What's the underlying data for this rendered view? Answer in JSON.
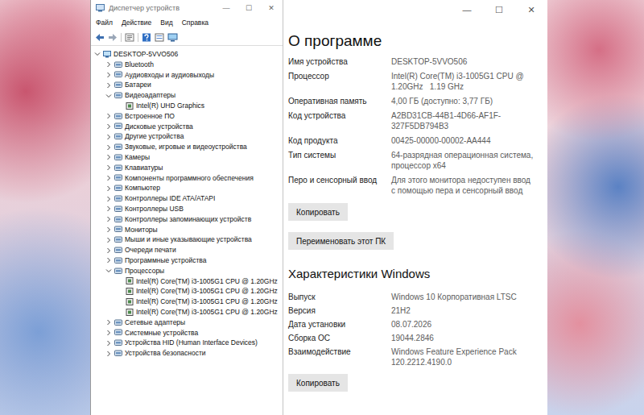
{
  "device_manager": {
    "title": "Диспетчер устройств",
    "controls": [
      "—",
      "☐",
      "✕"
    ],
    "menu": [
      "Файл",
      "Действие",
      "Вид",
      "Справка"
    ],
    "root": {
      "label": "DESKTOP-5VVO506",
      "expanded": true
    },
    "categories": [
      {
        "label": "Bluetooth",
        "expanded": false,
        "children": []
      },
      {
        "label": "Аудиовходы и аудиовыходы",
        "expanded": false,
        "children": []
      },
      {
        "label": "Батареи",
        "expanded": false,
        "children": []
      },
      {
        "label": "Видеоадаптеры",
        "expanded": true,
        "children": [
          "Intel(R) UHD Graphics"
        ]
      },
      {
        "label": "Встроенное ПО",
        "expanded": false,
        "children": []
      },
      {
        "label": "Дисковые устройства",
        "expanded": false,
        "children": []
      },
      {
        "label": "Другие устройства",
        "expanded": false,
        "children": []
      },
      {
        "label": "Звуковые, игровые и видеоустройства",
        "expanded": false,
        "children": []
      },
      {
        "label": "Камеры",
        "expanded": false,
        "children": []
      },
      {
        "label": "Клавиатуры",
        "expanded": false,
        "children": []
      },
      {
        "label": "Компоненты программного обеспечения",
        "expanded": false,
        "children": []
      },
      {
        "label": "Компьютер",
        "expanded": false,
        "children": []
      },
      {
        "label": "Контроллеры IDE ATA/ATAPI",
        "expanded": false,
        "children": []
      },
      {
        "label": "Контроллеры USB",
        "expanded": false,
        "children": []
      },
      {
        "label": "Контроллеры запоминающих устройств",
        "expanded": false,
        "children": []
      },
      {
        "label": "Мониторы",
        "expanded": false,
        "children": []
      },
      {
        "label": "Мыши и иные указывающие устройства",
        "expanded": false,
        "children": []
      },
      {
        "label": "Очереди печати",
        "expanded": false,
        "children": []
      },
      {
        "label": "Программные устройства",
        "expanded": false,
        "children": []
      },
      {
        "label": "Процессоры",
        "expanded": true,
        "children": [
          "Intel(R) Core(TM) i3-1005G1 CPU @ 1.20GHz",
          "Intel(R) Core(TM) i3-1005G1 CPU @ 1.20GHz",
          "Intel(R) Core(TM) i3-1005G1 CPU @ 1.20GHz",
          "Intel(R) Core(TM) i3-1005G1 CPU @ 1.20GHz"
        ]
      },
      {
        "label": "Сетевые адаптеры",
        "expanded": false,
        "children": []
      },
      {
        "label": "Системные устройства",
        "expanded": false,
        "children": []
      },
      {
        "label": "Устройства HID (Human Interface Devices)",
        "expanded": false,
        "children": []
      },
      {
        "label": "Устройства безопасности",
        "expanded": false,
        "children": []
      }
    ]
  },
  "about": {
    "controls": [
      "—",
      "☐",
      "✕"
    ],
    "heading": "О программе",
    "device_specs": [
      {
        "label": "Имя устройства",
        "value": "DESKTOP-5VVO506"
      },
      {
        "label": "Процессор",
        "value": "Intel(R) Core(TM) i3-1005G1 CPU @ 1.20GHz   1.19 GHz"
      },
      {
        "label": "Оперативная память",
        "value": "4,00 ГБ (доступно: 3,77 ГБ)"
      },
      {
        "label": "Код устройства",
        "value": "A2BD31CB-44B1-4D66-AF1F-327F5DB794B3"
      },
      {
        "label": "Код продукта",
        "value": "00425-00000-00002-AA444"
      },
      {
        "label": "Тип системы",
        "value": "64-разрядная операционная система, процессор x64"
      },
      {
        "label": "Перо и сенсорный ввод",
        "value": "Для этого монитора недоступен ввод с помощью пера и сенсорный ввод"
      }
    ],
    "device_buttons": [
      "Копировать",
      "Переименовать этот ПК"
    ],
    "windows_heading": "Характеристики Windows",
    "windows_specs": [
      {
        "label": "Выпуск",
        "value": "Windows 10 Корпоративная LTSC"
      },
      {
        "label": "Версия",
        "value": "21H2"
      },
      {
        "label": "Дата установки",
        "value": "08.07.2026"
      },
      {
        "label": "Сборка ОС",
        "value": "19044.2846"
      },
      {
        "label": "Взаимодействие",
        "value": "Windows Feature Experience Pack 120.2212.4190.0"
      }
    ],
    "windows_buttons": [
      "Копировать"
    ]
  }
}
